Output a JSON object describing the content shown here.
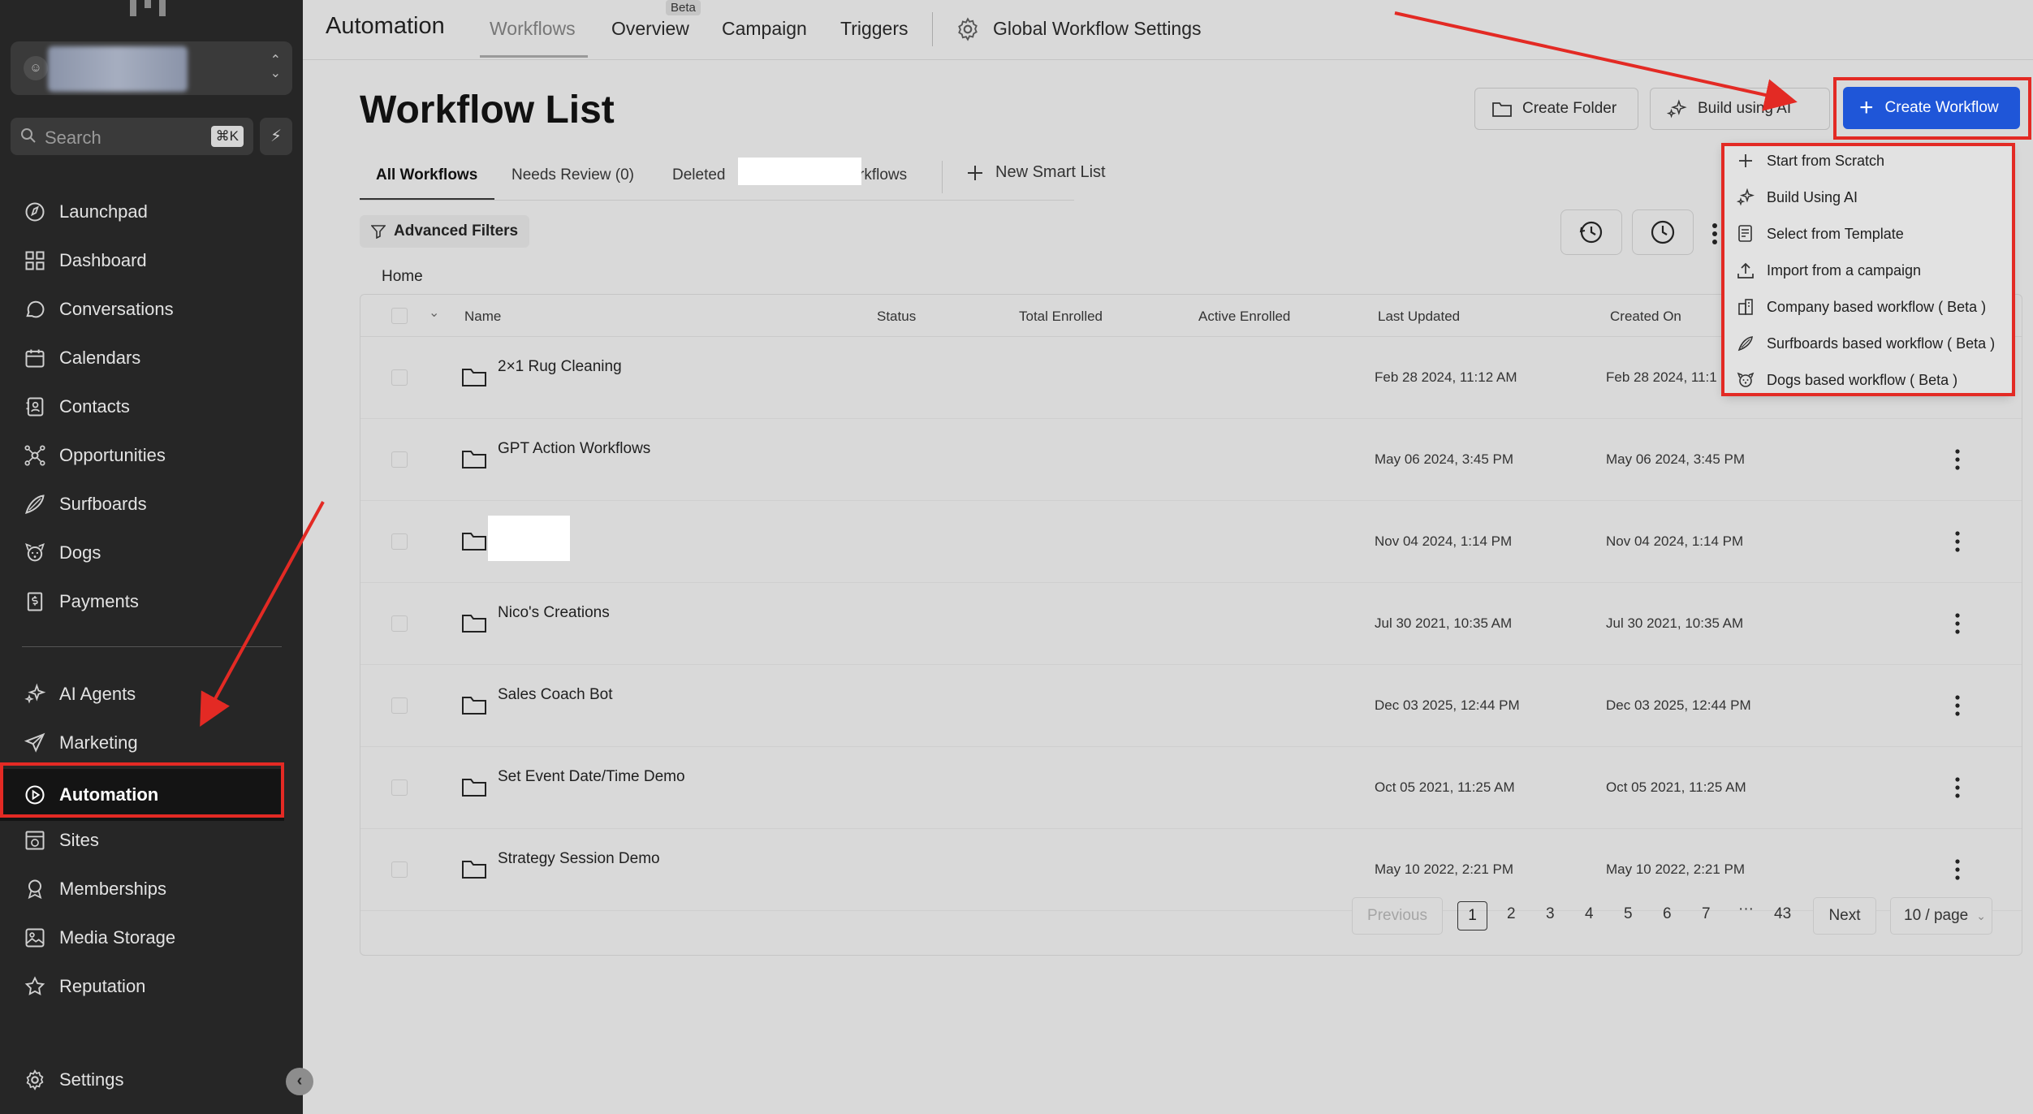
{
  "sidebar": {
    "search": {
      "placeholder": "Search",
      "shortcut": "⌘K"
    },
    "nav": [
      {
        "label": "Launchpad",
        "icon": "launchpad-icon"
      },
      {
        "label": "Dashboard",
        "icon": "dashboard-icon"
      },
      {
        "label": "Conversations",
        "icon": "chat-icon"
      },
      {
        "label": "Calendars",
        "icon": "calendar-icon"
      },
      {
        "label": "Contacts",
        "icon": "contacts-icon"
      },
      {
        "label": "Opportunities",
        "icon": "opportunities-icon"
      },
      {
        "label": "Surfboards",
        "icon": "surfboard-icon"
      },
      {
        "label": "Dogs",
        "icon": "dog-icon"
      },
      {
        "label": "Payments",
        "icon": "payments-icon"
      },
      {
        "label": "AI Agents",
        "icon": "sparkle-icon"
      },
      {
        "label": "Marketing",
        "icon": "send-icon"
      },
      {
        "label": "Automation",
        "icon": "automation-icon",
        "active": true
      },
      {
        "label": "Sites",
        "icon": "sites-icon"
      },
      {
        "label": "Memberships",
        "icon": "badge-icon"
      },
      {
        "label": "Media Storage",
        "icon": "image-icon"
      },
      {
        "label": "Reputation",
        "icon": "star-icon"
      }
    ],
    "settings_label": "Settings"
  },
  "topbar": {
    "title": "Automation",
    "tabs": [
      {
        "label": "Workflows",
        "selected": true
      },
      {
        "label": "Overview",
        "badge": "Beta"
      },
      {
        "label": "Campaign"
      },
      {
        "label": "Triggers"
      }
    ],
    "global_settings": "Global Workflow Settings"
  },
  "page": {
    "title": "Workflow List",
    "create_folder": "Create Folder",
    "build_ai": "Build using AI",
    "create_workflow": "Create Workflow",
    "subtabs": {
      "all": "All Workflows",
      "needs_review": "Needs Review (0)",
      "deleted": "Deleted",
      "deleted_suffix": "rkflows",
      "new_smart_list": "New Smart List"
    },
    "advanced_filters": "Advanced Filters",
    "breadcrumb": "Home"
  },
  "table": {
    "columns": [
      "Name",
      "Status",
      "Total Enrolled",
      "Active Enrolled",
      "Last Updated",
      "Created On"
    ],
    "rows": [
      {
        "name": "2×1 Rug Cleaning",
        "last_updated": "Feb 28 2024, 11:12 AM",
        "created_on": "Feb 28 2024, 11:1"
      },
      {
        "name": "GPT Action Workflows",
        "last_updated": "May 06 2024, 3:45 PM",
        "created_on": "May 06 2024, 3:45 PM"
      },
      {
        "name": "",
        "last_updated": "Nov 04 2024, 1:14 PM",
        "created_on": "Nov 04 2024, 1:14 PM"
      },
      {
        "name": "Nico's Creations",
        "last_updated": "Jul 30 2021, 10:35 AM",
        "created_on": "Jul 30 2021, 10:35 AM"
      },
      {
        "name": "Sales Coach Bot",
        "last_updated": "Dec 03 2025, 12:44 PM",
        "created_on": "Dec 03 2025, 12:44 PM"
      },
      {
        "name": "Set Event Date/Time Demo",
        "last_updated": "Oct 05 2021, 11:25 AM",
        "created_on": "Oct 05 2021, 11:25 AM"
      },
      {
        "name": "Strategy Session Demo",
        "last_updated": "May 10 2022, 2:21 PM",
        "created_on": "May 10 2022, 2:21 PM"
      }
    ]
  },
  "pagination": {
    "previous": "Previous",
    "pages": [
      "1",
      "2",
      "3",
      "4",
      "5",
      "6",
      "7",
      "···",
      "43"
    ],
    "current": "1",
    "next": "Next",
    "per_page": "10 / page"
  },
  "dropdown": {
    "items": [
      {
        "label": "Start from Scratch",
        "icon": "plus-icon"
      },
      {
        "label": "Build Using AI",
        "icon": "sparkle-icon"
      },
      {
        "label": "Select from Template",
        "icon": "template-icon"
      },
      {
        "label": "Import from a campaign",
        "icon": "upload-icon"
      },
      {
        "label": "Company based workflow ( Beta )",
        "icon": "building-icon"
      },
      {
        "label": "Surfboards based workflow ( Beta )",
        "icon": "surfboard-icon"
      },
      {
        "label": "Dogs based workflow ( Beta )",
        "icon": "dog-icon"
      }
    ]
  },
  "colors": {
    "sidebar_bg": "#262626",
    "primary": "#1f56d8",
    "annotation_red": "#e32a24"
  }
}
